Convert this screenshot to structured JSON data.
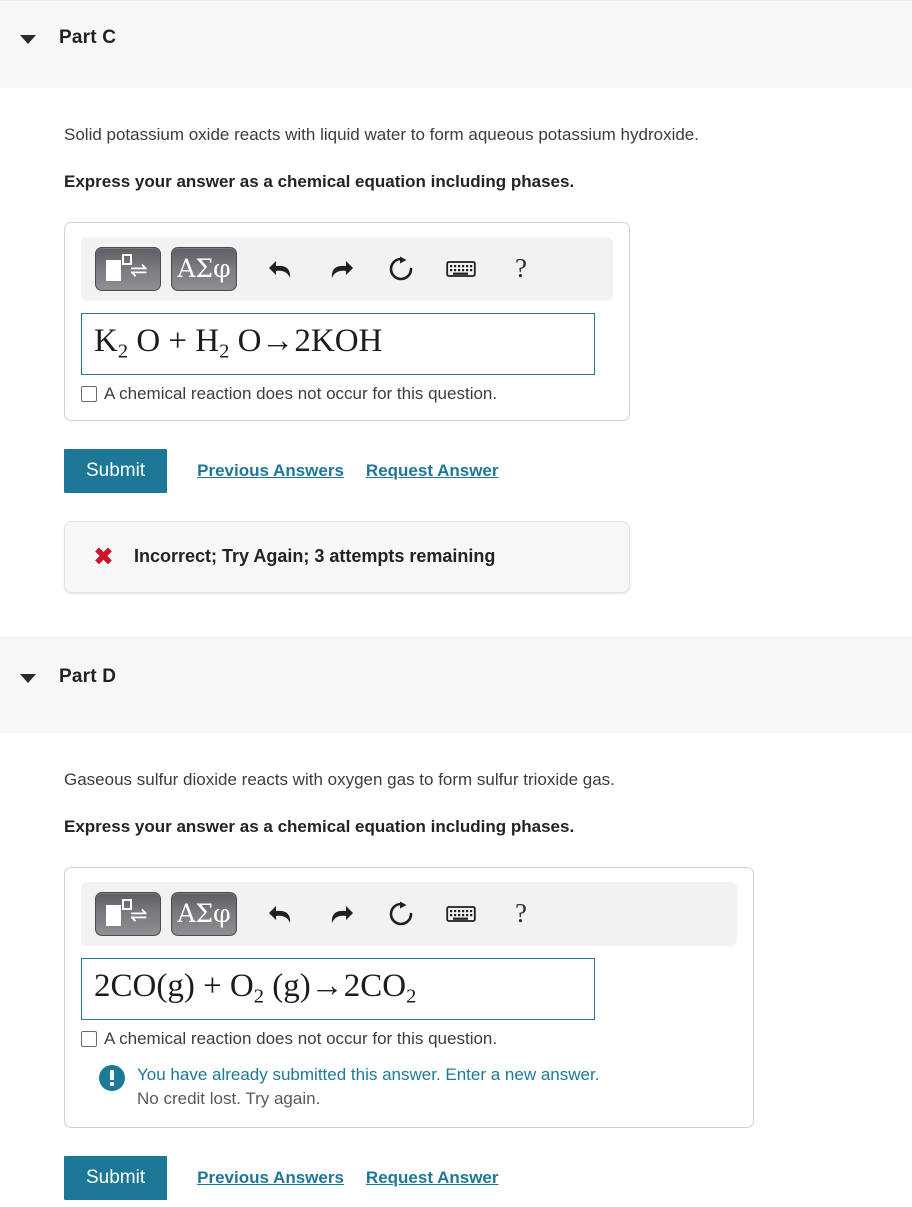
{
  "parts": [
    {
      "id": "part-c",
      "title": "Part C",
      "caret_icon": "caret-down-icon",
      "prompt": "Solid potassium oxide reacts with liquid water to form aqueous potassium hydroxide.",
      "instruction": "Express your answer as a chemical equation including phases.",
      "toolbar": {
        "template_button_label": "template-icon",
        "greek_button_label": "ΑΣφ",
        "undo_icon": "undo-arrow-icon",
        "redo_icon": "redo-arrow-icon",
        "reset_icon": "reset-circular-arrow-icon",
        "keyboard_icon": "keyboard-icon",
        "help_label": "?"
      },
      "answer": {
        "equation_html": "K<sub>2</sub> O + H<sub>2</sub> O→2KOH",
        "equation_text": "K2 O + H2 O→2KOH"
      },
      "checkbox": {
        "checked": false,
        "label": "A chemical reaction does not occur for this question."
      },
      "actions": {
        "submit_label": "Submit",
        "previous_answers_label": "Previous Answers",
        "request_answer_label": "Request Answer"
      },
      "feedback": {
        "icon": "red-x-icon",
        "text": "Incorrect; Try Again; 3 attempts remaining",
        "color": "#d01129"
      }
    },
    {
      "id": "part-d",
      "title": "Part D",
      "caret_icon": "caret-down-icon",
      "prompt": "Gaseous sulfur dioxide reacts with oxygen gas to form sulfur trioxide gas.",
      "instruction": "Express your answer as a chemical equation including phases.",
      "toolbar": {
        "template_button_label": "template-icon",
        "greek_button_label": "ΑΣφ",
        "undo_icon": "undo-arrow-icon",
        "redo_icon": "redo-arrow-icon",
        "reset_icon": "reset-circular-arrow-icon",
        "keyboard_icon": "keyboard-icon",
        "help_label": "?"
      },
      "answer": {
        "equation_html": "2CO(g) + O<sub>2</sub> (g)→2CO<sub>2</sub>",
        "equation_text": "2CO(g) + O2 (g)→2CO2"
      },
      "checkbox": {
        "checked": false,
        "label": "A chemical reaction does not occur for this question."
      },
      "info": {
        "icon": "info-exclamation-icon",
        "line1": "You have already submitted this answer. Enter a new answer.",
        "line2": "No credit lost. Try again.",
        "line1_color": "#1e7898"
      },
      "actions": {
        "submit_label": "Submit",
        "previous_answers_label": "Previous Answers",
        "request_answer_label": "Request Answer"
      }
    }
  ],
  "colors": {
    "accent": "#1d7898",
    "header_band": "#f7f7f7",
    "error": "#d01129",
    "input_border": "#2a7494"
  }
}
